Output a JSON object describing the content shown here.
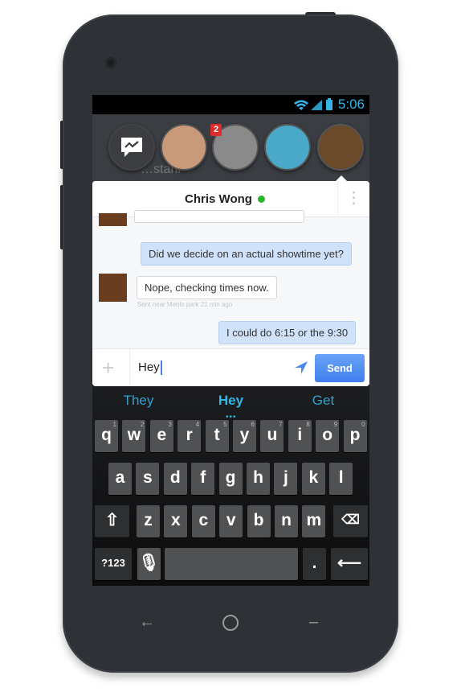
{
  "status_bar": {
    "time": "5:06",
    "icons": [
      "wifi-icon",
      "signal-icon",
      "battery-icon"
    ],
    "accent": "#33b5e5"
  },
  "background_app": {
    "partial_text": "…stahl"
  },
  "chat_heads": [
    {
      "type": "messenger",
      "icon": "messenger-icon"
    },
    {
      "initials": "",
      "color": "#c89a7a"
    },
    {
      "initials": "",
      "color": "#8a8a8a",
      "badge": "2"
    },
    {
      "initials": "",
      "color": "#4aa8c8"
    },
    {
      "initials": "",
      "color": "#6b4a2a"
    }
  ],
  "conversation": {
    "contact_name": "Chris Wong",
    "online": true,
    "online_color": "#2bb52b",
    "messages": [
      {
        "from": "me",
        "text": "Did we decide on an actual showtime yet?"
      },
      {
        "from": "them",
        "text": "Nope, checking times now.",
        "meta": "Sent near Menlo park 21 min ago"
      },
      {
        "from": "me",
        "text": "I could do 6:15 or the 9:30"
      }
    ]
  },
  "composer": {
    "value": "Hey",
    "send_label": "Send",
    "send_color": "#4a86f0"
  },
  "keyboard": {
    "suggestions": [
      "They",
      "Hey",
      "Get"
    ],
    "rows": [
      [
        "q",
        "w",
        "e",
        "r",
        "t",
        "y",
        "u",
        "i",
        "o",
        "p"
      ],
      [
        "a",
        "s",
        "d",
        "f",
        "g",
        "h",
        "j",
        "k",
        "l"
      ],
      [
        "z",
        "x",
        "c",
        "v",
        "b",
        "n",
        "m"
      ]
    ],
    "hints": [
      "1",
      "2",
      "3",
      "4",
      "5",
      "6",
      "7",
      "8",
      "9",
      "0"
    ],
    "symbols_label": "?123",
    "period_label": "."
  },
  "nav_bar": {
    "icons": [
      "back-icon",
      "home-icon",
      "menu-icon"
    ]
  }
}
